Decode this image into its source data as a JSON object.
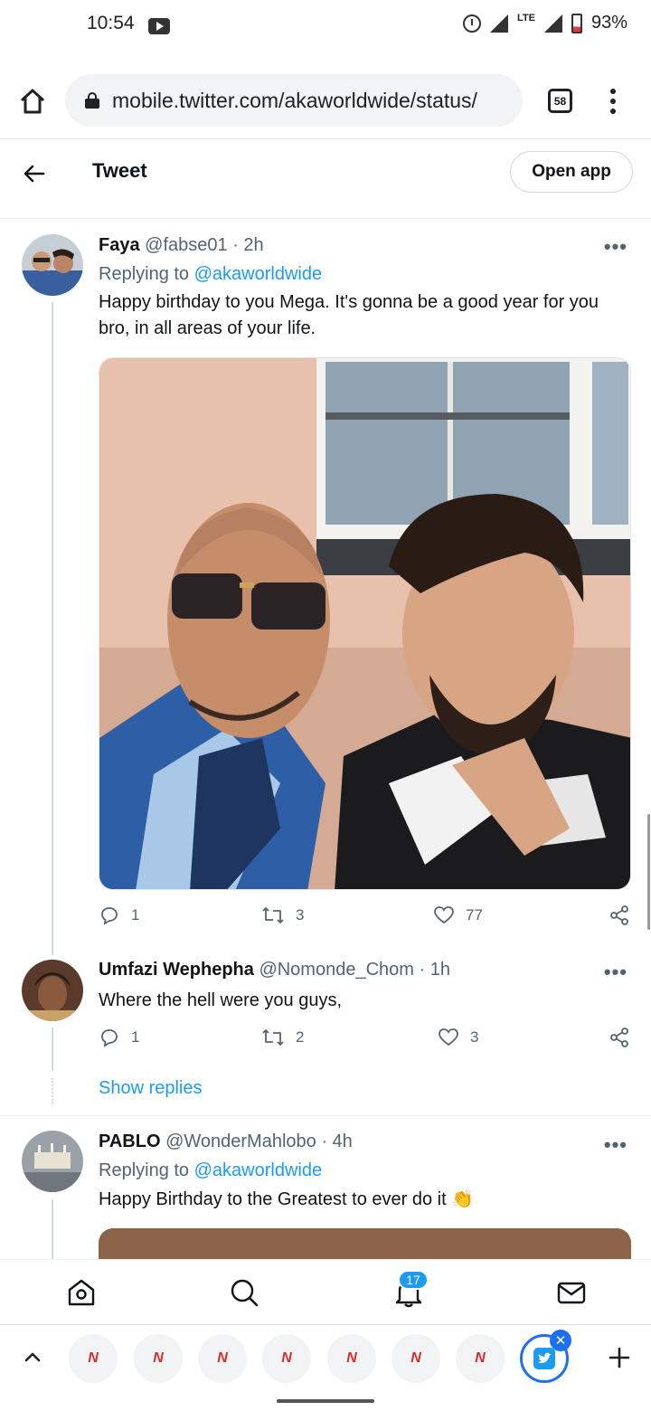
{
  "status_bar": {
    "time": "10:54",
    "network": "LTE",
    "battery": "93%"
  },
  "browser": {
    "url": "mobile.twitter.com/akaworldwide/status/",
    "tabs_count": "58"
  },
  "header": {
    "title": "Tweet",
    "open_app_label": "Open app"
  },
  "tweets": [
    {
      "name": "Faya",
      "handle": "@fabse01",
      "time": "· 2h",
      "replying_prefix": "Replying to",
      "replying_to": "@akaworldwide",
      "text": "Happy birthday to you Mega. It's gonna be a good year for you bro, in all areas of your life.",
      "replies": "1",
      "retweets": "3",
      "likes": "77"
    },
    {
      "name": "Umfazi Wephepha",
      "handle": "@Nomonde_Chom",
      "time": "· 1h",
      "text": "Where the hell were you guys,",
      "replies": "1",
      "retweets": "2",
      "likes": "3",
      "show_replies": "Show replies"
    },
    {
      "name": "PABLO",
      "handle": "@WonderMahlobo",
      "time": "· 4h",
      "replying_prefix": "Replying to",
      "replying_to": "@akaworldwide",
      "text": "Happy Birthday to the Greatest to ever do it 👏"
    }
  ],
  "bottom_nav": {
    "notification_count": "17"
  },
  "bubbles": {
    "label": "N"
  },
  "colors": {
    "accent": "#1d9bf0",
    "text": "#0f1419",
    "muted": "#536471"
  }
}
